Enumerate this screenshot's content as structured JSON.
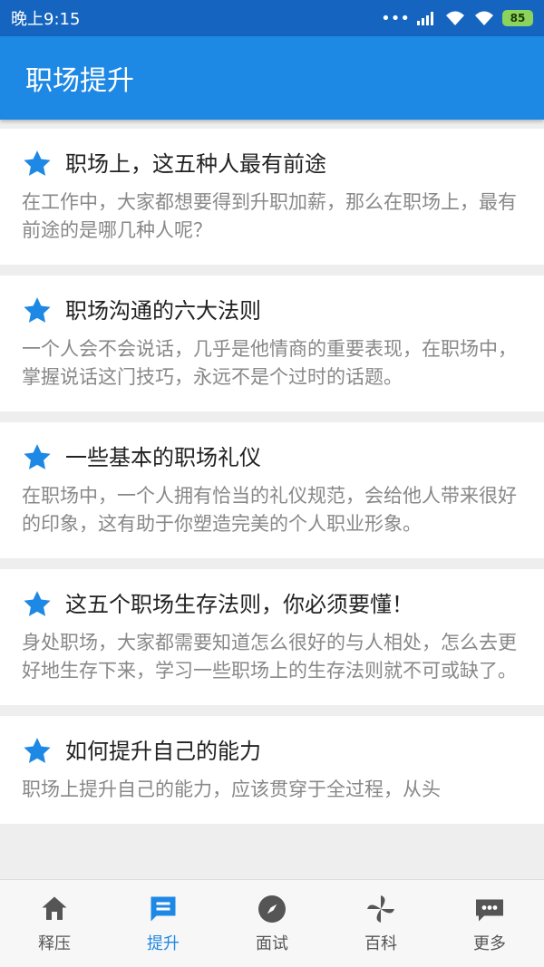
{
  "status": {
    "time": "晚上9:15",
    "battery": "85"
  },
  "appbar": {
    "title": "职场提升"
  },
  "articles": [
    {
      "title": "职场上，这五种人最有前途",
      "desc": "在工作中，大家都想要得到升职加薪，那么在职场上，最有前途的是哪几种人呢？"
    },
    {
      "title": "职场沟通的六大法则",
      "desc": "一个人会不会说话，几乎是他情商的重要表现，在职场中，掌握说话这门技巧，永远不是个过时的话题。"
    },
    {
      "title": "一些基本的职场礼仪",
      "desc": "在职场中，一个人拥有恰当的礼仪规范，会给他人带来很好的印象，这有助于你塑造完美的个人职业形象。"
    },
    {
      "title": "这五个职场生存法则，你必须要懂！",
      "desc": "身处职场，大家都需要知道怎么很好的与人相处，怎么去更好地生存下来，学习一些职场上的生存法则就不可或缺了。"
    },
    {
      "title": "如何提升自己的能力",
      "desc": "职场上提升自己的能力，应该贯穿于全过程，从头"
    }
  ],
  "tabs": [
    {
      "label": "释压",
      "icon": "home-icon"
    },
    {
      "label": "提升",
      "icon": "message-icon"
    },
    {
      "label": "面试",
      "icon": "compass-icon"
    },
    {
      "label": "百科",
      "icon": "pinwheel-icon"
    },
    {
      "label": "更多",
      "icon": "more-icon"
    }
  ],
  "colors": {
    "primary": "#1e88e5",
    "statusbar": "#1565c0",
    "star": "#1e88e5"
  }
}
